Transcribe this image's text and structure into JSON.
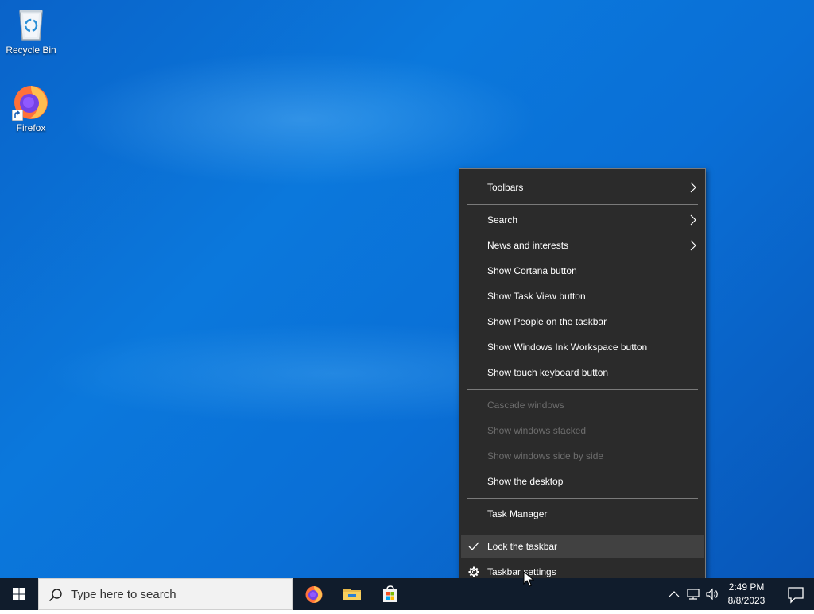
{
  "desktop": {
    "icons": [
      {
        "label": "Recycle Bin"
      },
      {
        "label": "Firefox"
      }
    ]
  },
  "context_menu": {
    "items": [
      {
        "label": "Toolbars",
        "submenu": true
      },
      {
        "label": "Search",
        "submenu": true
      },
      {
        "label": "News and interests",
        "submenu": true
      },
      {
        "label": "Show Cortana button"
      },
      {
        "label": "Show Task View button"
      },
      {
        "label": "Show People on the taskbar"
      },
      {
        "label": "Show Windows Ink Workspace button"
      },
      {
        "label": "Show touch keyboard button"
      },
      {
        "label": "Cascade windows",
        "disabled": true
      },
      {
        "label": "Show windows stacked",
        "disabled": true
      },
      {
        "label": "Show windows side by side",
        "disabled": true
      },
      {
        "label": "Show the desktop"
      },
      {
        "label": "Task Manager"
      },
      {
        "label": "Lock the taskbar",
        "checked": true,
        "highlighted": true
      },
      {
        "label": "Taskbar settings",
        "icon": "gear-icon"
      }
    ]
  },
  "taskbar": {
    "search_placeholder": "Type here to search",
    "pinned_apps": [
      "firefox-icon",
      "file-explorer-icon",
      "microsoft-store-icon"
    ],
    "clock": {
      "time": "2:49 PM",
      "date": "8/8/2023"
    }
  },
  "colors": {
    "menu_bg": "#2b2b2b",
    "menu_highlight": "#414141",
    "menu_disabled_text": "#6d6d6d",
    "taskbar_bg": "#101c2c",
    "desktop_blue": "#0b78dc"
  }
}
